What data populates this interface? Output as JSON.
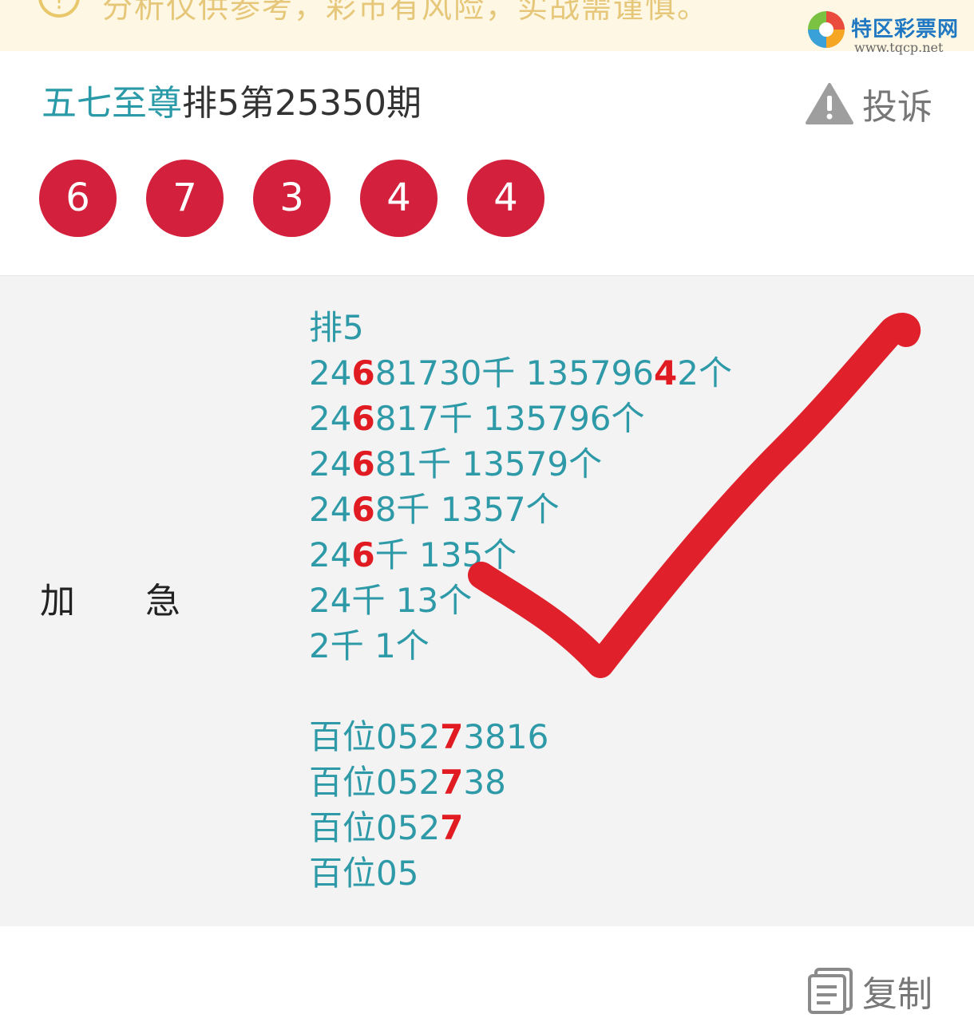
{
  "notice": {
    "text": "分析仅供参考，彩市有风险，实战需谨慎。",
    "icon": "info-circle-icon"
  },
  "watermark": {
    "title": "特区彩票网",
    "url": "www.tqcp.net"
  },
  "header": {
    "author": "五七至尊",
    "issue": "排5第25350期",
    "complain_label": "投诉",
    "complain_icon": "warning-triangle-icon"
  },
  "balls": [
    "6",
    "7",
    "3",
    "4",
    "4"
  ],
  "content": {
    "label": "加　　急",
    "lines": [
      [
        {
          "t": "排5"
        }
      ],
      [
        {
          "t": "24"
        },
        {
          "t": "6",
          "h": true
        },
        {
          "t": "81730千 135796"
        },
        {
          "t": "4",
          "h": true
        },
        {
          "t": "2个"
        }
      ],
      [
        {
          "t": "24"
        },
        {
          "t": "6",
          "h": true
        },
        {
          "t": "817千 135796个"
        }
      ],
      [
        {
          "t": "24"
        },
        {
          "t": "6",
          "h": true
        },
        {
          "t": "81千 13579个"
        }
      ],
      [
        {
          "t": "24"
        },
        {
          "t": "6",
          "h": true
        },
        {
          "t": "8千 1357个"
        }
      ],
      [
        {
          "t": "24"
        },
        {
          "t": "6",
          "h": true
        },
        {
          "t": "千 135个"
        }
      ],
      [
        {
          "t": "24千 13个"
        }
      ],
      [
        {
          "t": "2千 1个"
        }
      ],
      [],
      [
        {
          "t": "百位052"
        },
        {
          "t": "7",
          "h": true
        },
        {
          "t": "3816"
        }
      ],
      [
        {
          "t": "百位052"
        },
        {
          "t": "7",
          "h": true
        },
        {
          "t": "38"
        }
      ],
      [
        {
          "t": "百位052"
        },
        {
          "t": "7",
          "h": true
        }
      ],
      [
        {
          "t": "百位05"
        }
      ]
    ]
  },
  "copy": {
    "label": "复制",
    "icon": "document-copy-icon"
  },
  "colors": {
    "teal": "#2e9aa8",
    "highlight": "#e11b22",
    "ball": "#d3203c",
    "check": "#e0202a"
  }
}
